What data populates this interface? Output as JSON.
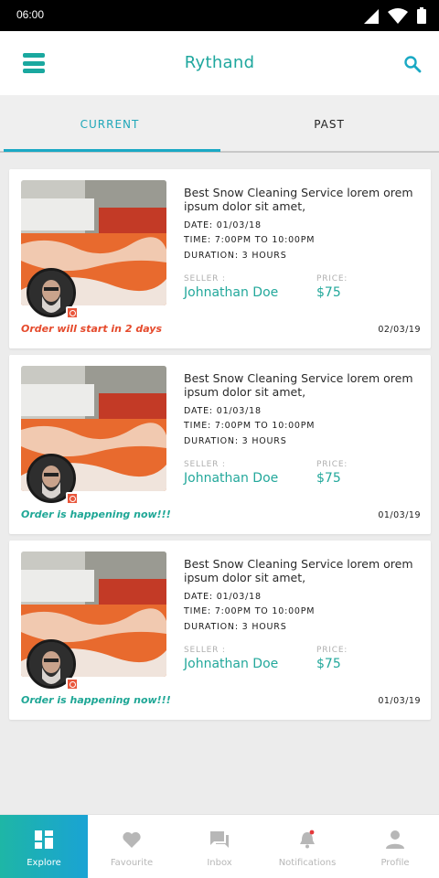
{
  "status_bar": {
    "time": "06:00"
  },
  "app_bar": {
    "title": "Rythand"
  },
  "tabs": [
    {
      "label": "CURRENT"
    },
    {
      "label": "PAST"
    }
  ],
  "orders": [
    {
      "title": "Best Snow Cleaning Service lorem orem ipsum dolor sit amet,",
      "date": "DATE: 01/03/18",
      "time": "TIME: 7:00PM TO 10:00PM",
      "duration": "DURATION: 3 HOURS",
      "seller_label": "SELLER :",
      "seller": "Johnathan Doe",
      "price_label": "PRICE:",
      "price": "$75",
      "status": "Order will start in 2 days",
      "status_color": "#e54a2c",
      "card_date": "02/03/19"
    },
    {
      "title": "Best Snow Cleaning Service lorem orem ipsum dolor sit amet,",
      "date": "DATE: 01/03/18",
      "time": "TIME: 7:00PM TO 10:00PM",
      "duration": "DURATION: 3 HOURS",
      "seller_label": "SELLER :",
      "seller": "Johnathan Doe",
      "price_label": "PRICE:",
      "price": "$75",
      "status": "Order is happening now!!!",
      "status_color": "#1fa796",
      "card_date": "01/03/19"
    },
    {
      "title": "Best Snow Cleaning Service lorem orem ipsum dolor sit amet,",
      "date": "DATE: 01/03/18",
      "time": "TIME: 7:00PM TO 10:00PM",
      "duration": "DURATION: 3 HOURS",
      "seller_label": "SELLER :",
      "seller": "Johnathan Doe",
      "price_label": "PRICE:",
      "price": "$75",
      "status": "Order is happening now!!!",
      "status_color": "#1fa796",
      "card_date": "01/03/19"
    }
  ],
  "bottom_nav": [
    {
      "label": "Explore",
      "icon": "explore-icon",
      "active": true
    },
    {
      "label": "Favourite",
      "icon": "heart-icon"
    },
    {
      "label": "Inbox",
      "icon": "chat-icon"
    },
    {
      "label": "Notifications",
      "icon": "bell-icon"
    },
    {
      "label": "Profile",
      "icon": "person-icon"
    }
  ],
  "colors": {
    "accent": "#1fa79e",
    "tab_active": "#1fa7b9",
    "alert": "#e54a2c"
  }
}
